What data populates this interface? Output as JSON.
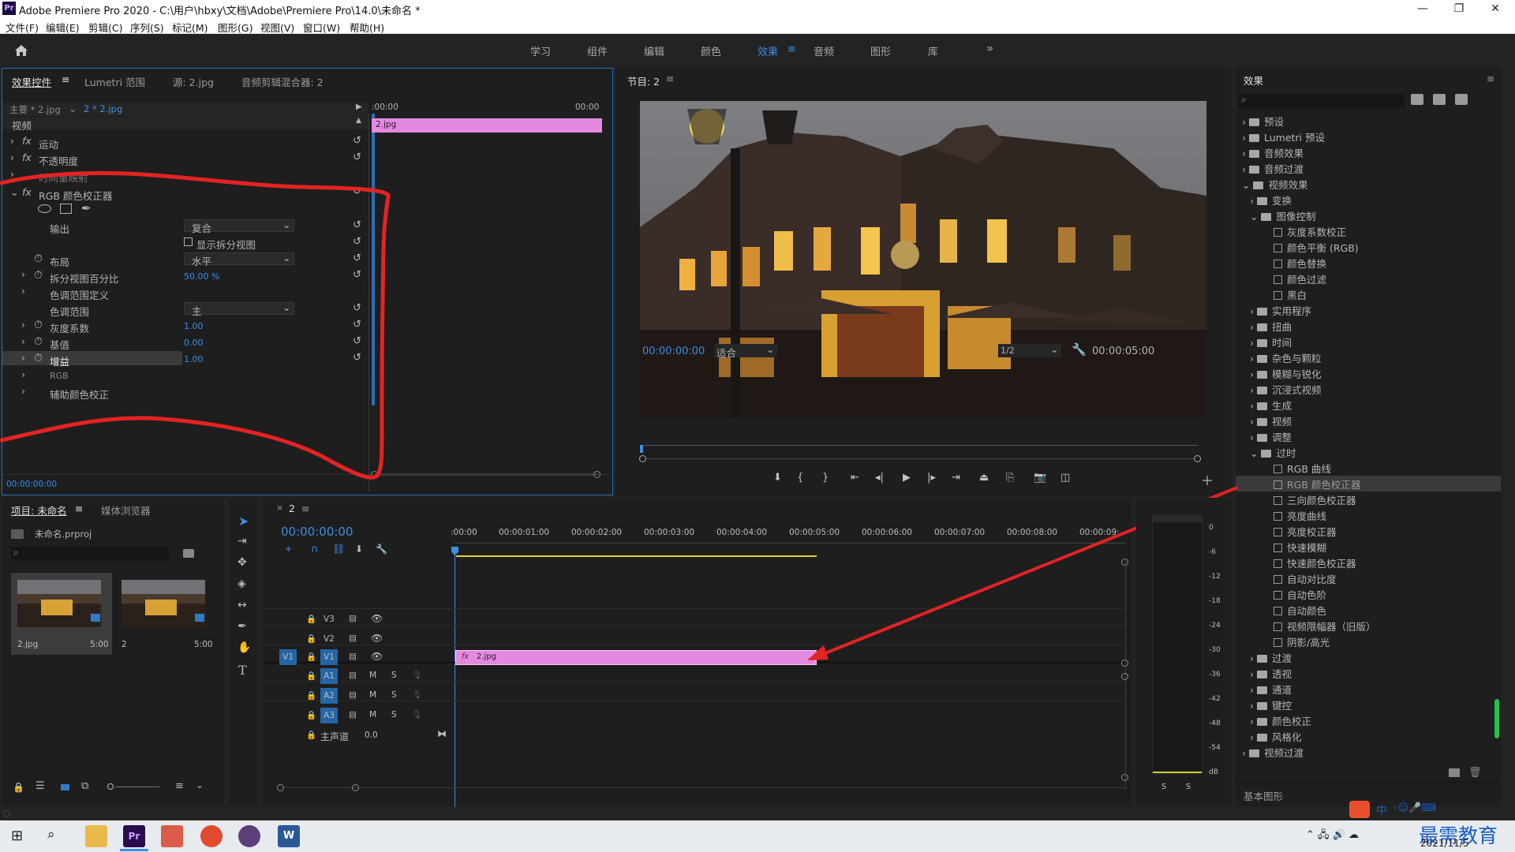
{
  "titlebar": {
    "icon": "Pr",
    "title": "Adobe Premiere Pro 2020 - C:\\用户\\hbxy\\文档\\Adobe\\Premiere Pro\\14.0\\未命名 *",
    "minimize": "—",
    "maximize": "❐",
    "close": "✕"
  },
  "menu": [
    "文件(F)",
    "编辑(E)",
    "剪辑(C)",
    "序列(S)",
    "标记(M)",
    "图形(G)",
    "视图(V)",
    "窗口(W)",
    "帮助(H)"
  ],
  "workspaces": [
    "学习",
    "组件",
    "编辑",
    "颜色",
    "效果",
    "音频",
    "图形",
    "库"
  ],
  "active_workspace": "效果",
  "workspace_more": "»",
  "effect_controls": {
    "tabs": [
      "效果控件",
      "Lumetri 范围",
      "源: 2.jpg",
      "音频剪辑混合器: 2"
    ],
    "master": "主要 * 2.jpg",
    "clip": "2 * 2.jpg",
    "tl_start": ":00:00",
    "tl_end": "00:00",
    "clip_label": "2.jpg",
    "section_video": "视频",
    "fx_motion": "运动",
    "fx_opacity": "不透明度",
    "fx_time": "时间重映射",
    "fx_rgb": "RGB 颜色校正器",
    "prop_output": "输出",
    "output_value": "复合",
    "split_view": "显示拆分视图",
    "prop_layout": "布局",
    "layout_value": "水平",
    "prop_split_pct": "拆分视图百分比",
    "split_pct_value": "50.00 %",
    "prop_tonal_def": "色调范围定义",
    "prop_tonal": "色调范围",
    "tonal_value": "主",
    "prop_gamma": "灰度系数",
    "gamma_value": "1.00",
    "prop_pedestal": "基值",
    "pedestal_value": "0.00",
    "prop_gain": "增益",
    "gain_value": "1.00",
    "prop_rgb": "RGB",
    "prop_secondary": "辅助颜色校正",
    "timecode": "00:00:00:00"
  },
  "program": {
    "title": "节目: 2",
    "timecode": "00:00:00:00",
    "fit": "适合",
    "quality": "1/2",
    "duration": "00:00:05:00"
  },
  "project": {
    "tabs": [
      "项目: 未命名",
      "媒体浏览器"
    ],
    "file": "未命名.prproj",
    "items": [
      {
        "name": "2.jpg",
        "duration": "5:00"
      },
      {
        "name": "2",
        "duration": "5:00"
      }
    ]
  },
  "timeline": {
    "seq": "2",
    "timecode": "00:00:00:00",
    "ruler": [
      ":00:00",
      "00:00:01:00",
      "00:00:02:00",
      "00:00:03:00",
      "00:00:04:00",
      "00:00:05:00",
      "00:00:06:00",
      "00:00:07:00",
      "00:00:08:00",
      "00:00:09:"
    ],
    "tracks_video": [
      "V3",
      "V2",
      "V1"
    ],
    "tracks_audio": [
      "A1",
      "A2",
      "A3"
    ],
    "master": "主声道",
    "master_value": "0.0",
    "source_patch": "V1",
    "clip_label": "2.jpg",
    "mute": "M",
    "solo": "S"
  },
  "meter": {
    "scale": [
      "0",
      "-6",
      "-12",
      "-18",
      "-24",
      "-30",
      "-36",
      "-42",
      "-48",
      "-54",
      "dB"
    ],
    "solo_left": "S",
    "solo_right": "S"
  },
  "effects": {
    "title": "效果",
    "top": [
      "预设",
      "Lumetri 预设",
      "音频效果",
      "音频过渡",
      "视频效果"
    ],
    "video_folders": [
      "变换",
      "图像控制"
    ],
    "image_control": [
      "灰度系数校正",
      "颜色平衡 (RGB)",
      "颜色替换",
      "颜色过滤",
      "黑白"
    ],
    "more_folders": [
      "实用程序",
      "扭曲",
      "时间",
      "杂色与颗粒",
      "模糊与锐化",
      "沉浸式视频",
      "生成",
      "视频",
      "调整",
      "过时"
    ],
    "obsolete": [
      "RGB 曲线",
      "RGB 颜色校正器",
      "三向颜色校正器",
      "亮度曲线",
      "亮度校正器",
      "快速模糊",
      "快速颜色校正器",
      "自动对比度",
      "自动色阶",
      "自动颜色",
      "视频限幅器（旧版）",
      "阴影/高光"
    ],
    "tail_folders": [
      "过渡",
      "透视",
      "通道",
      "键控",
      "颜色校正",
      "风格化"
    ],
    "last": "视频过渡",
    "essential": "基本图形"
  },
  "tray": {
    "ime": "中",
    "date": "2021/11/5",
    "watermark": "最需教育"
  },
  "colors": {
    "accent": "#3c8ee6",
    "clip": "#e38ae0",
    "annotation": "#e42323"
  }
}
